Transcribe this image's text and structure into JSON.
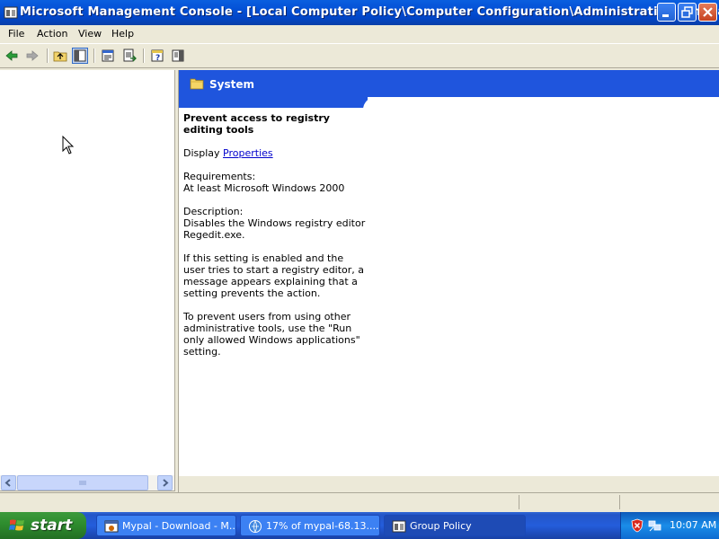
{
  "window": {
    "title": "Microsoft Management Console - [Local Computer Policy\\Computer Configuration\\Administrative Templates]"
  },
  "menu": [
    "File",
    "Action",
    "View",
    "Help"
  ],
  "toolbar": {
    "icons": [
      "back-arrow-icon",
      "forward-arrow-icon",
      "up-folder-icon",
      "show-hide-tree-icon",
      "properties-icon",
      "export-list-icon",
      "help-icon",
      "show-hide-action-pane-icon"
    ]
  },
  "right_pane": {
    "section_title": "System",
    "setting_title": "Prevent access to registry editing tools",
    "display_label": "Display",
    "display_link": "Properties",
    "requirements_label": "Requirements:",
    "requirements_value": "At least Microsoft Windows 2000",
    "description_label": "Description:",
    "description_p1": "Disables the Windows registry editor Regedit.exe.",
    "description_p2": "If this setting is enabled and the user tries to start a registry editor, a message appears explaining that a setting prevents the action.",
    "description_p3": "To prevent users from using other administrative tools, use the \"Run only allowed Windows applications\" setting."
  },
  "taskbar": {
    "start_label": "start",
    "tasks": [
      {
        "label": "Mypal - Download - M...",
        "icon": "mypal-icon"
      },
      {
        "label": "17% of mypal-68.13....",
        "icon": "download-icon"
      },
      {
        "label": "Group Policy",
        "icon": "mmc-icon"
      }
    ],
    "clock": "10:07 AM"
  },
  "colors": {
    "title_bar": "#0553D8",
    "banner": "#1F55DD",
    "taskbar": "#245DDB",
    "start_button": "#2F8E2F"
  }
}
